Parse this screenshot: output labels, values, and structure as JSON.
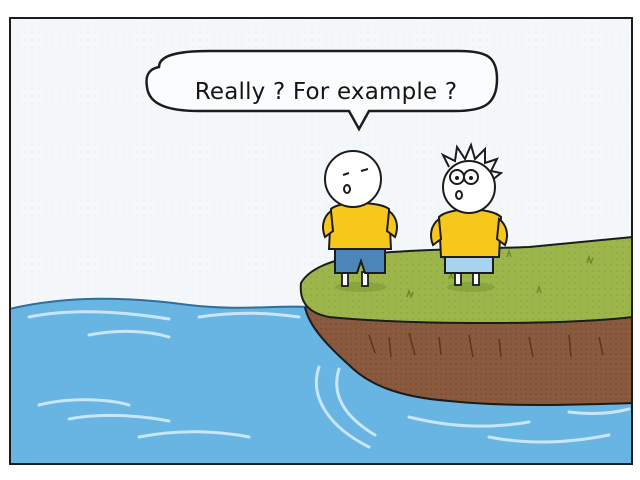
{
  "speech_bubble": {
    "text": "Really ? For example ?"
  },
  "colors": {
    "sky": "#f5f8fb",
    "water": "#68b4e2",
    "grass": "#9cb64c",
    "soil": "#8a5a3e",
    "shirt": "#f6c81c",
    "shorts_bald": "#4c86b6",
    "shorts_spiky": "#a7d3ef",
    "outline": "#1c1c1c"
  },
  "scene": {
    "characters": [
      "bald-character",
      "spiky-hair-character"
    ],
    "setting": "cliff-by-the-sea"
  }
}
